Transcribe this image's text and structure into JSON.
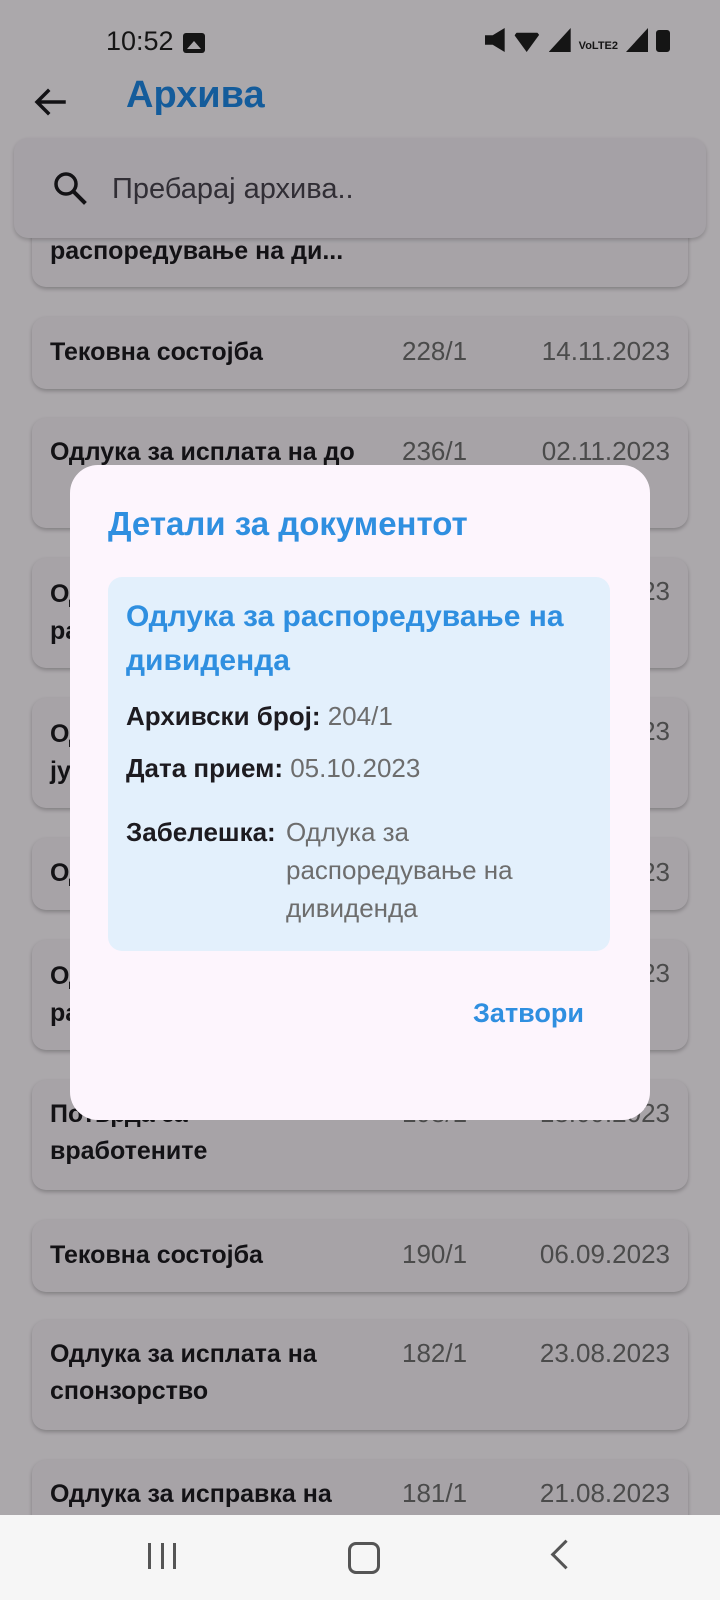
{
  "status_bar": {
    "time": "10:52",
    "lte_label": "VoLTE2"
  },
  "app_bar": {
    "title": "Архива"
  },
  "search": {
    "placeholder": "Пребарај архива.."
  },
  "list": {
    "items": [
      {
        "title": "распоредување на ди...",
        "number": "",
        "date": ""
      },
      {
        "title": "Тековна состојба",
        "number": "228/1",
        "date": "14.11.2023"
      },
      {
        "title": "Одлука за исплата на до",
        "number": "236/1",
        "date": "02.11.2023"
      },
      {
        "title": "Од ра",
        "number": "",
        "date": "23"
      },
      {
        "title": "Од ју",
        "number": "",
        "date": "23"
      },
      {
        "title": "Од",
        "number": "",
        "date": "23"
      },
      {
        "title": "Од ра",
        "number": "",
        "date": "23"
      },
      {
        "title": "Потврда за вработените",
        "number": "198/1",
        "date": "18.09.2023"
      },
      {
        "title": "Тековна состојба",
        "number": "190/1",
        "date": "06.09.2023"
      },
      {
        "title": "Одлука за исплата на спонзорство",
        "number": "182/1",
        "date": "23.08.2023"
      },
      {
        "title": "Одлука за исправка на",
        "number": "181/1",
        "date": "21.08.2023"
      }
    ]
  },
  "dialog": {
    "title": "Детали за документот",
    "doc_title": "Одлука за распоредување на дивиденда",
    "archive_label": "Архивски број:",
    "archive_value": "204/1",
    "date_label": "Дата прием:",
    "date_value": "05.10.2023",
    "note_label": "Забелешка:",
    "note_value": "Одлука за распоредување на дивиденда",
    "close_label": "Затвори"
  },
  "colors": {
    "accent": "#1e88e5",
    "dialog_bg": "#fdf5fd",
    "detail_bg": "#e3f0fc"
  }
}
